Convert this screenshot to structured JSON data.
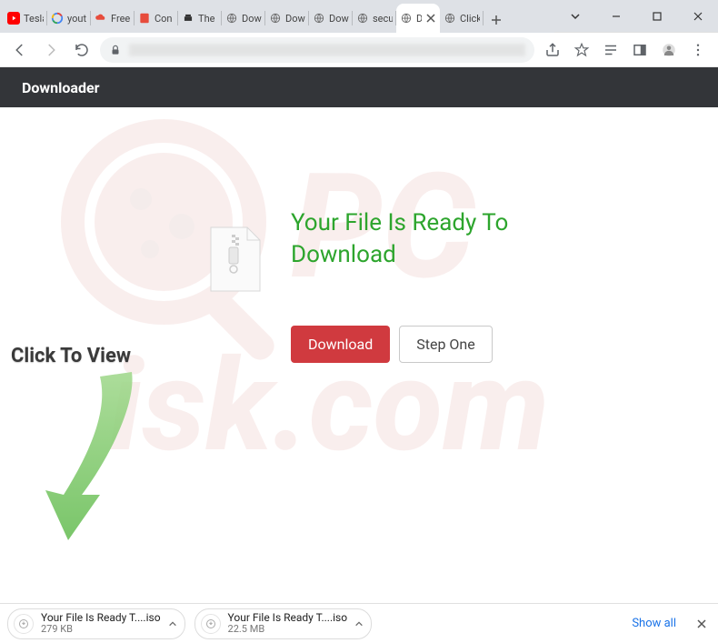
{
  "tabs": [
    {
      "title": "Tesla"
    },
    {
      "title": "yout"
    },
    {
      "title": "Free"
    },
    {
      "title": "Con"
    },
    {
      "title": "The"
    },
    {
      "title": "Dow"
    },
    {
      "title": "Dow"
    },
    {
      "title": "Dow"
    },
    {
      "title": "secu"
    },
    {
      "title": "D"
    },
    {
      "title": "Click"
    }
  ],
  "page": {
    "header": "Downloader",
    "headline": "Your File Is Ready To Download",
    "download_label": "Download",
    "step_one_label": "Step One",
    "click_to_view": "Click To View"
  },
  "downloads": {
    "items": [
      {
        "name": "Your File Is Ready T....iso",
        "size": "279 KB"
      },
      {
        "name": "Your File Is Ready T....iso",
        "size": "22.5 MB"
      }
    ],
    "show_all": "Show all"
  }
}
